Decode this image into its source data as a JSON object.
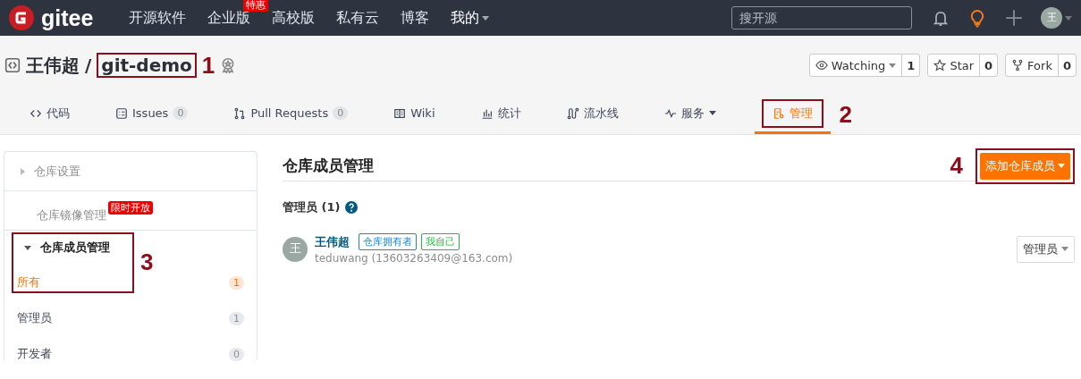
{
  "navbar": {
    "logo": "gitee",
    "items": [
      {
        "label": "开源软件"
      },
      {
        "label": "企业版",
        "badge": "特惠"
      },
      {
        "label": "高校版"
      },
      {
        "label": "私有云"
      },
      {
        "label": "博客"
      },
      {
        "label": "我的",
        "dropdown": true
      }
    ],
    "search": {
      "placeholder": "搜开源"
    },
    "avatar": "王"
  },
  "repo": {
    "owner": "王伟超",
    "separator": "/",
    "name": "git-demo",
    "callout": "1"
  },
  "actions": [
    {
      "kind": "watch",
      "label": "Watching",
      "dropdown": true,
      "count": "1"
    },
    {
      "kind": "star",
      "label": "Star",
      "count": "0"
    },
    {
      "kind": "fork",
      "label": "Fork",
      "count": "0"
    }
  ],
  "tabs": [
    {
      "kind": "code",
      "label": "代码",
      "selected": false
    },
    {
      "kind": "issues",
      "label": "Issues",
      "count": "0",
      "selected": false
    },
    {
      "kind": "pulls",
      "label": "Pull Requests",
      "count": "0",
      "selected": false
    },
    {
      "kind": "wiki",
      "label": "Wiki",
      "selected": false
    },
    {
      "kind": "stats",
      "label": "统计",
      "selected": false
    },
    {
      "kind": "pipeline",
      "label": "流水线",
      "selected": false
    },
    {
      "kind": "service",
      "label": "服务",
      "dropdown": true,
      "selected": false
    },
    {
      "kind": "manage",
      "label": "管理",
      "selected": true,
      "callout": "2"
    }
  ],
  "sidebar": [
    {
      "label": "仓库设置",
      "expanded": false
    },
    {
      "label": "仓库镜像管理",
      "badge": "限时开放"
    },
    {
      "label": "仓库成员管理",
      "expanded": true,
      "callout": "3",
      "children": [
        {
          "label": "所有",
          "count": "1",
          "selected": true
        },
        {
          "label": "管理员",
          "count": "1",
          "selected": false
        },
        {
          "label": "开发者",
          "count": "0",
          "selected": false
        }
      ]
    }
  ],
  "main": {
    "title": "仓库成员管理",
    "add_button": {
      "label": "添加仓库成员",
      "callout": "4"
    },
    "groups": [
      {
        "title": "管理员 (1)",
        "members": [
          {
            "avatar": "王",
            "name": "王伟超",
            "tags": [
              {
                "label": "仓库拥有者",
                "color": "#2185d0"
              },
              {
                "label": "我自己",
                "color": "#21ba45"
              }
            ],
            "email": "teduwang (13603263409@163.com)",
            "role": "管理员"
          }
        ]
      }
    ]
  }
}
